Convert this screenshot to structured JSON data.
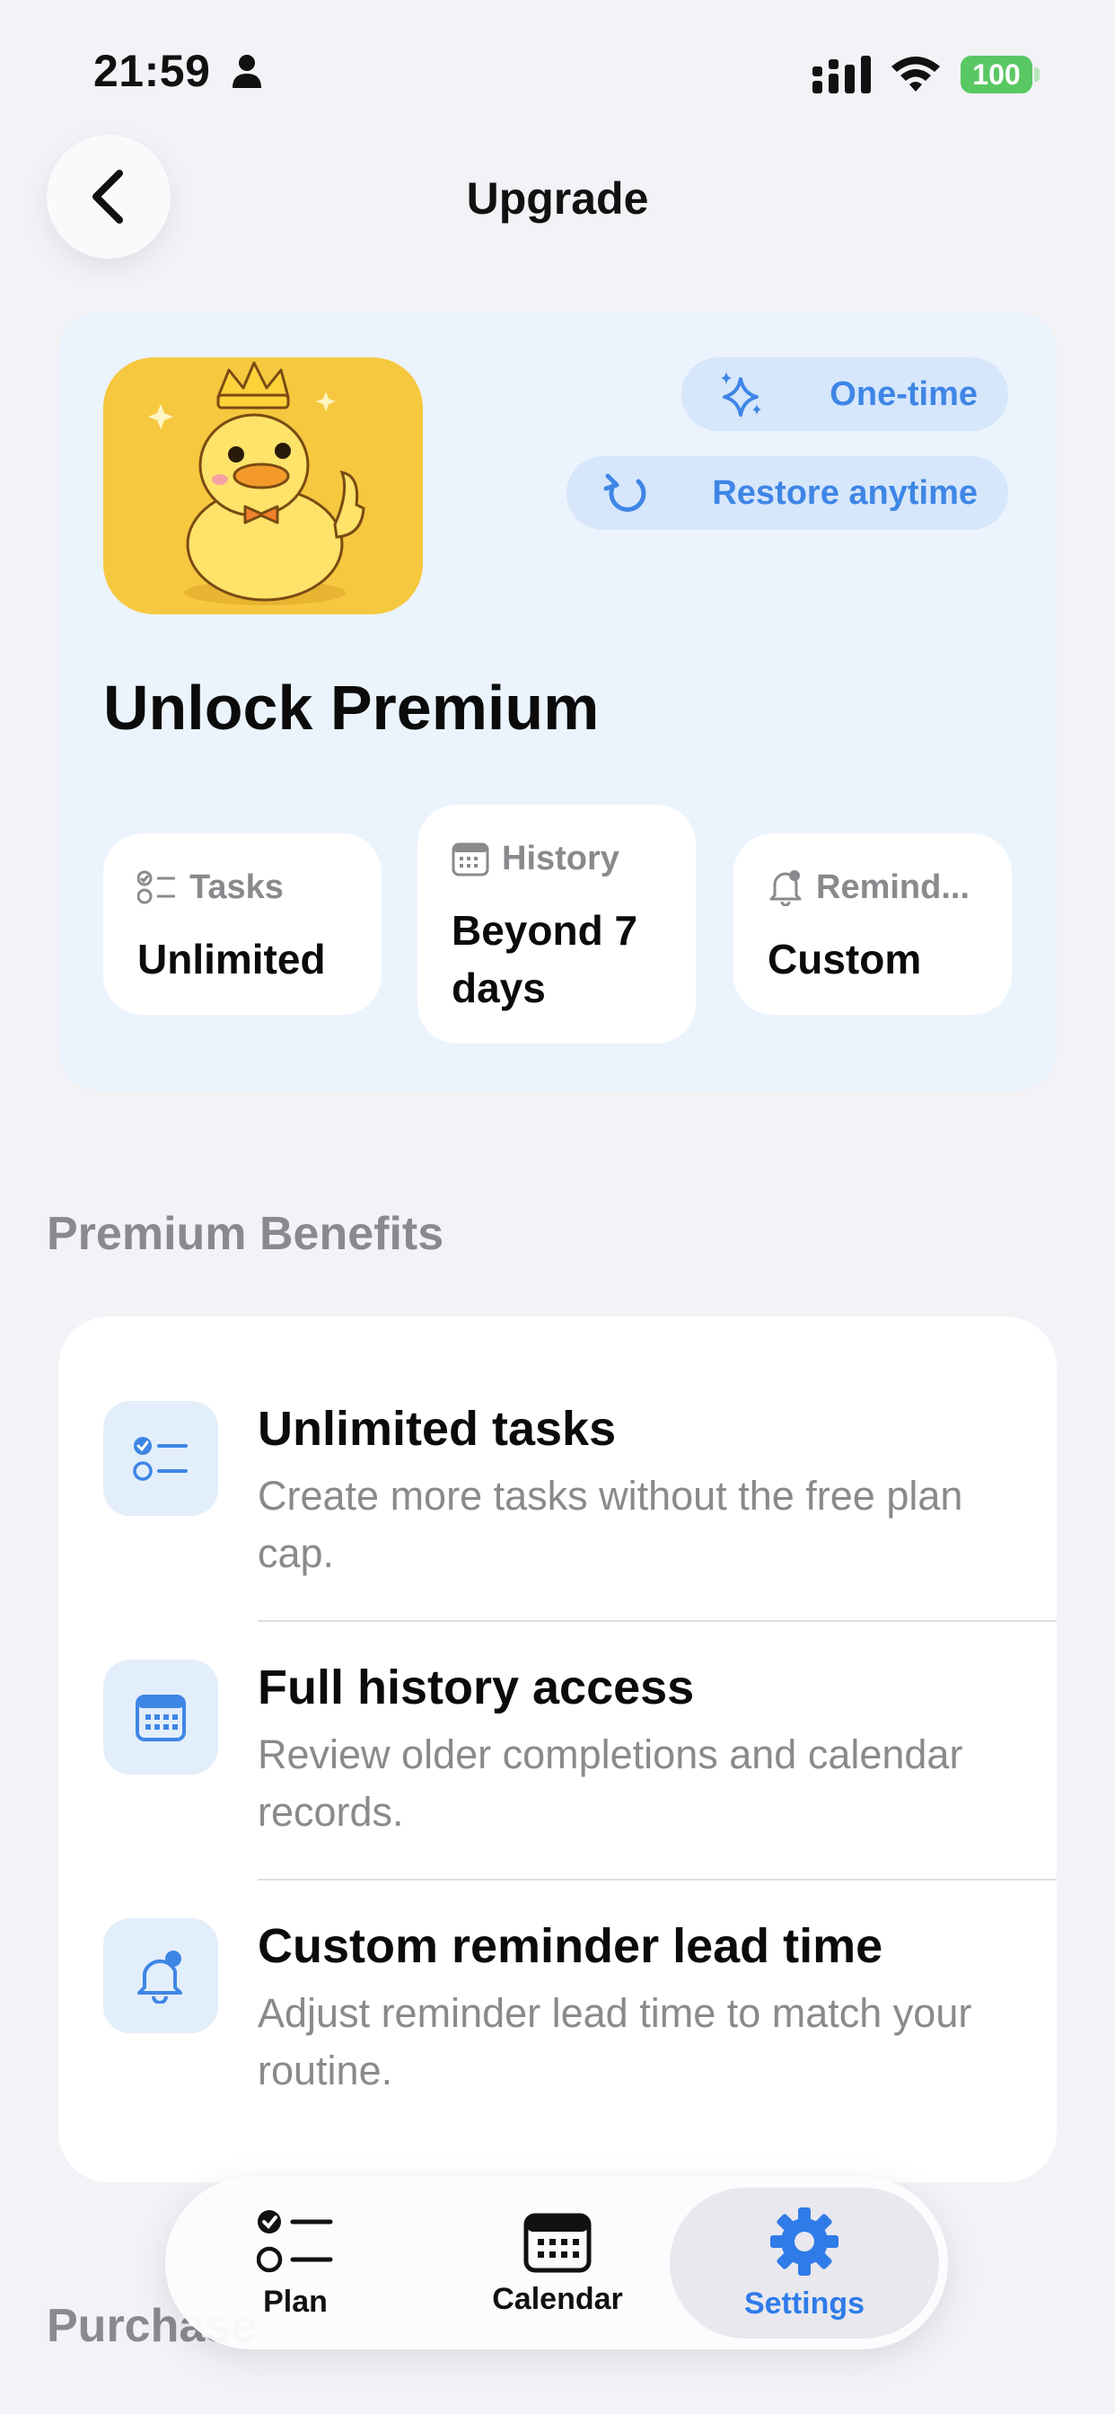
{
  "status_bar": {
    "time": "21:59",
    "battery": "100"
  },
  "nav": {
    "title": "Upgrade"
  },
  "hero": {
    "pills": {
      "one_time": "One-time",
      "restore": "Restore anytime"
    },
    "title": "Unlock Premium",
    "stats": [
      {
        "icon": "checklist-icon",
        "label": "Tasks",
        "value": "Unlimited"
      },
      {
        "icon": "calendar-icon",
        "label": "History",
        "value": "Beyond 7 days"
      },
      {
        "icon": "bell-icon",
        "label": "Remind...",
        "value": "Custom"
      }
    ]
  },
  "benefits_section": {
    "title": "Premium Benefits",
    "items": [
      {
        "icon": "checklist-icon",
        "title": "Unlimited tasks",
        "description": "Create more tasks without the free plan cap."
      },
      {
        "icon": "calendar-icon",
        "title": "Full history access",
        "description": "Review older completions and calendar records."
      },
      {
        "icon": "bell-icon",
        "title": "Custom reminder lead time",
        "description": "Adjust reminder lead time to match your routine."
      }
    ]
  },
  "purchase_section": {
    "title": "Purchase"
  },
  "tabbar": {
    "tabs": [
      {
        "label": "Plan",
        "icon": "checklist-icon"
      },
      {
        "label": "Calendar",
        "icon": "calendar-icon"
      },
      {
        "label": "Settings",
        "icon": "gear-icon",
        "selected": true
      }
    ]
  },
  "colors": {
    "accent": "#3e86e6",
    "hero_background": "#ebf3fd",
    "mascot_background": "#f6c83f",
    "battery": "#59c862"
  }
}
